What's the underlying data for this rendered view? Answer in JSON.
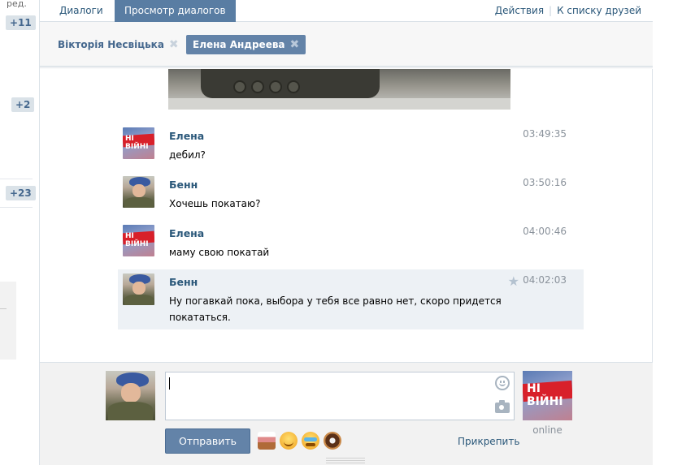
{
  "left_strip": {
    "label": "ред.",
    "badges": [
      "+11",
      "+2",
      "+23"
    ]
  },
  "tabs": {
    "dialogs": "Диалоги",
    "view_dialogs": "Просмотр диалогов",
    "actions": "Действия",
    "separator": "|",
    "to_friends": "К списку друзей"
  },
  "peers": [
    {
      "name": "Вікторія Несвіцька",
      "active": false
    },
    {
      "name": "Елена Андреева",
      "active": true
    }
  ],
  "messages": [
    {
      "author": "Елена",
      "text": "дебил?",
      "time": "03:49:35",
      "avatar": "elena",
      "highlighted": false
    },
    {
      "author": "Бенн",
      "text": "Хочешь покатаю?",
      "time": "03:50:16",
      "avatar": "benn",
      "highlighted": false
    },
    {
      "author": "Елена",
      "text": "маму свою покатай",
      "time": "04:00:46",
      "avatar": "elena",
      "highlighted": false
    },
    {
      "author": "Бенн",
      "text": "Ну погавкай пока, выбора у тебя все равно нет, скоро придется покататься.",
      "time": "04:02:03",
      "avatar": "benn",
      "highlighted": true
    }
  ],
  "avatar_text": {
    "elena": "НІ ВІЙНІ"
  },
  "composer": {
    "input_value": "",
    "send_label": "Отправить",
    "attach_label": "Прикрепить",
    "peer_status": "online",
    "emoji_icons": [
      "cake-icon",
      "smile-emoji-icon",
      "tears-emoji-icon",
      "donut-icon"
    ]
  },
  "colors": {
    "accent": "#597da3",
    "button": "#6383a8",
    "link": "#2b587a",
    "highlight_row": "#edf1f5"
  }
}
